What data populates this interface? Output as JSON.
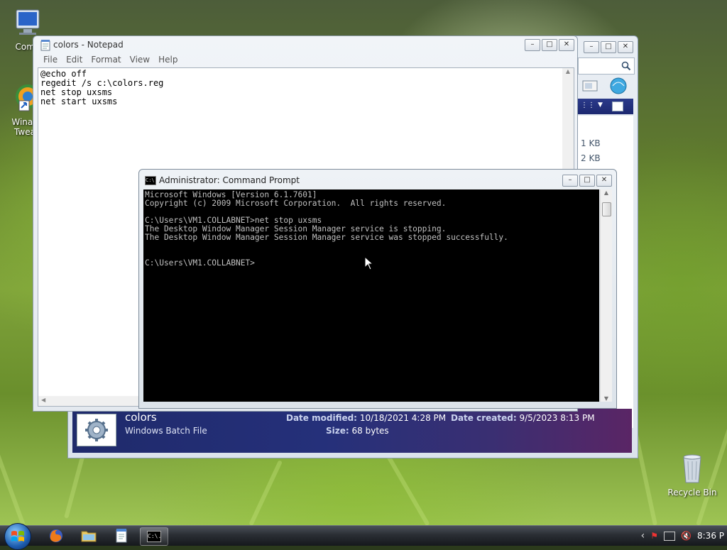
{
  "desktop": {
    "icons": [
      {
        "label": "Comp"
      },
      {
        "label": "Winae Twea"
      },
      {
        "label": "Recycle Bin"
      }
    ]
  },
  "explorer": {
    "sizes": [
      "1 KB",
      "2 KB"
    ],
    "details": {
      "name": "colors",
      "type": "Windows Batch File",
      "date_modified_label": "Date modified:",
      "date_modified": "10/18/2021 4:28 PM",
      "size_label": "Size:",
      "size": "68 bytes",
      "date_created_label": "Date created:",
      "date_created": "9/5/2023 8:13 PM"
    }
  },
  "notepad": {
    "title": "colors - Notepad",
    "menu": [
      "File",
      "Edit",
      "Format",
      "View",
      "Help"
    ],
    "content": "@echo off\nregedit /s c:\\colors.reg\nnet stop uxsms\nnet start uxsms"
  },
  "cmd": {
    "title": "Administrator: Command Prompt",
    "icon_text": "C:\\.",
    "output": "Microsoft Windows [Version 6.1.7601]\nCopyright (c) 2009 Microsoft Corporation.  All rights reserved.\n\nC:\\Users\\VM1.COLLABNET>net stop uxsms\nThe Desktop Window Manager Session Manager service is stopping.\nThe Desktop Window Manager Session Manager service was stopped successfully.\n\n\nC:\\Users\\VM1.COLLABNET>"
  },
  "taskbar": {
    "items": [
      "start-orb",
      "firefox",
      "explorer",
      "notepad",
      "command-prompt"
    ],
    "clock": "8:36 P"
  },
  "window_buttons": {
    "minimize": "–",
    "maximize": "□",
    "close": "✕"
  }
}
